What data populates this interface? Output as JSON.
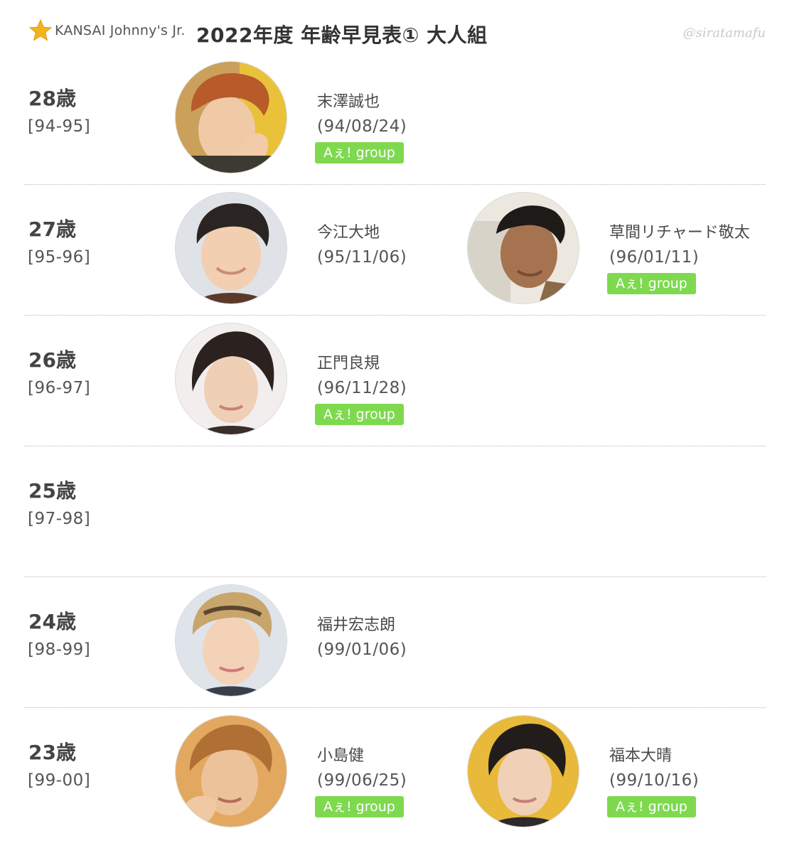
{
  "header": {
    "logo_text": "KANSAI Johnny's Jr.",
    "title": "2022年度 年齢早見表① 大人組",
    "watermark": "@siratamafu"
  },
  "colors": {
    "badge_green": "#7ed94f",
    "star_gold": "#f5b31b",
    "divider": "#b5b5b5"
  },
  "rows": [
    {
      "age": "28歳",
      "range": "[94-95]",
      "members": [
        {
          "name": "末澤誠也",
          "birth": "(94/08/24)",
          "badge": "Aぇ! group",
          "photo": "photo-suezawa"
        }
      ]
    },
    {
      "age": "27歳",
      "range": "[95-96]",
      "members": [
        {
          "name": "今江大地",
          "birth": "(95/11/06)",
          "photo": "photo-imae"
        },
        {
          "name": "草間リチャード敬太",
          "birth": "(96/01/11)",
          "badge": "Aぇ! group",
          "photo": "photo-kusama"
        }
      ]
    },
    {
      "age": "26歳",
      "range": "[96-97]",
      "members": [
        {
          "name": "正門良規",
          "birth": "(96/11/28)",
          "badge": "Aぇ! group",
          "photo": "photo-masakado"
        }
      ]
    },
    {
      "age": "25歳",
      "range": "[97-98]",
      "members": []
    },
    {
      "age": "24歳",
      "range": "[98-99]",
      "members": [
        {
          "name": "福井宏志朗",
          "birth": "(99/01/06)",
          "photo": "photo-fukui"
        }
      ]
    },
    {
      "age": "23歳",
      "range": "[99-00]",
      "members": [
        {
          "name": "小島健",
          "birth": "(99/06/25)",
          "badge": "Aぇ! group",
          "photo": "photo-kojima"
        },
        {
          "name": "福本大晴",
          "birth": "(99/10/16)",
          "badge": "Aぇ! group",
          "photo": "photo-fukumoto"
        }
      ]
    }
  ]
}
